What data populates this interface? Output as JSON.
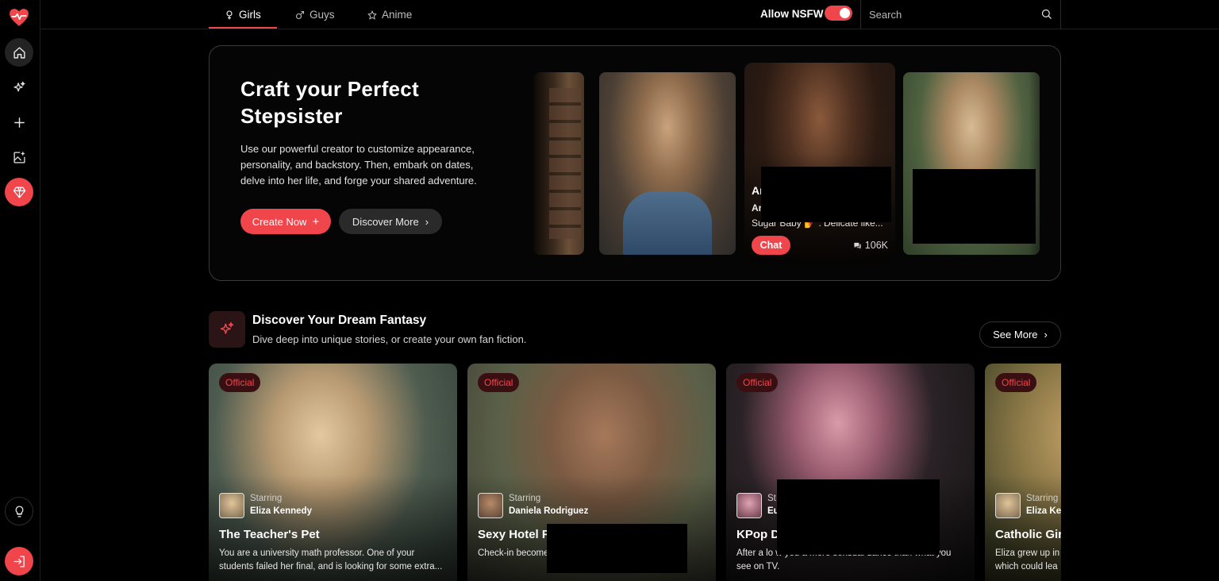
{
  "nav": {
    "tabs": [
      {
        "label": "Girls",
        "icon": "female-icon"
      },
      {
        "label": "Guys",
        "icon": "male-icon"
      },
      {
        "label": "Anime",
        "icon": "star-icon"
      }
    ],
    "active_tab": "Girls",
    "nsfw_label": "Allow NSFW",
    "nsfw_enabled": true,
    "search_placeholder": "Search"
  },
  "sidebar": {
    "items": [
      "home-icon",
      "sparkles-icon",
      "plus-icon",
      "image-edit-icon",
      "gem-icon"
    ],
    "bottom": [
      "bulb-icon",
      "login-icon"
    ]
  },
  "hero": {
    "title": "Craft your Perfect Stepsister",
    "description": "Use our powerful creator to customize appearance, personality, and backstory. Then, embark on dates, delve into her life, and forge your shared adventure.",
    "create_label": "Create Now",
    "discover_label": "Discover More",
    "featured": {
      "name": "Ar",
      "subtitle": "Ar",
      "tagline": "Sugar Baby 💅 : Delicate like...",
      "chat_label": "Chat",
      "chat_count": "106K"
    }
  },
  "section": {
    "title": "Discover Your Dream Fantasy",
    "subtitle": "Dive deep into unique stories, or create your own fan fiction.",
    "see_more_label": "See More"
  },
  "stories": [
    {
      "badge": "Official",
      "starring_label": "Starring",
      "starring_name": "Eliza Kennedy",
      "title": "The Teacher's Pet",
      "description": "You are a university math professor. One of your students failed her final, and is looking for some extra..."
    },
    {
      "badge": "Official",
      "starring_label": "Starring",
      "starring_name": "Daniela Rodriguez",
      "title": "Sexy Hotel Re",
      "description": "Check-in become Daniela's lingerin"
    },
    {
      "badge": "Official",
      "starring_label": "St",
      "starring_name": "Eu",
      "title": "KPop D",
      "description": "After a lo                                  w you a more sensual dance than what you see on TV."
    },
    {
      "badge": "Official",
      "starring_label": "Starring",
      "starring_name": "Eliza Ke",
      "title": "Catholic Girl",
      "description": "Eliza grew up in which could lea"
    }
  ],
  "colors": {
    "accent": "#f0454b",
    "background": "#000000",
    "badge_bg": "#3a0f12"
  }
}
